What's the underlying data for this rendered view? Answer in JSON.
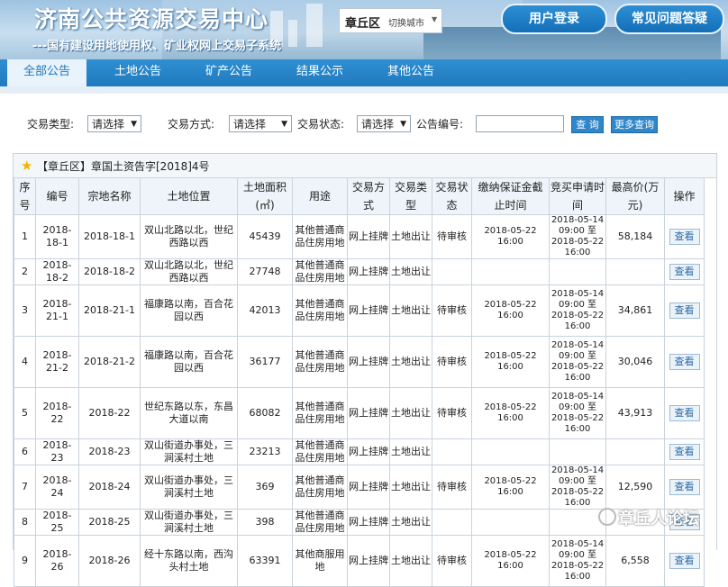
{
  "header": {
    "title": "济南公共资源交易中心",
    "subtitle": "---国有建设用地使用权、矿业权网上交易子系统",
    "city": "章丘区",
    "city_switch": "切换城市",
    "login_label": "用户登录",
    "faq_label": "常见问题答疑"
  },
  "nav": {
    "tabs": [
      "全部公告",
      "土地公告",
      "矿产公告",
      "结果公示",
      "其他公告"
    ],
    "active": "全部公告"
  },
  "filter": {
    "type_label": "交易类型:",
    "type_value": "请选择",
    "mode_label": "交易方式:",
    "mode_value": "请选择",
    "status_label": "交易状态:",
    "status_value": "请选择",
    "code_label": "公告编号:",
    "code_value": "",
    "query_label": "查 询",
    "more_label": "更多查询"
  },
  "caption": "【章丘区】章国土资告字[2018]4号",
  "table": {
    "headers": [
      "序号",
      "编号",
      "宗地名称",
      "土地位置",
      "土地面积(㎡)",
      "用途",
      "交易方式",
      "交易类型",
      "交易状态",
      "缴纳保证金截止时间",
      "竞买申请时间",
      "最高价(万元)",
      "操作"
    ],
    "rows": [
      {
        "no": "1",
        "code": "2018-18-1",
        "name": "2018-18-1",
        "loc": "双山北路以北，世纪西路以西",
        "area": "45439",
        "use": "其他普通商品住房用地",
        "mode": "网上挂牌",
        "type": "土地出让",
        "status": "待审核",
        "deposit": "2018-05-22 16:00",
        "apply": "2018-05-14 09:00 至 2018-05-22 16:00",
        "price": "58,184",
        "op": "查看"
      },
      {
        "no": "2",
        "code": "2018-18-2",
        "name": "2018-18-2",
        "loc": "双山北路以北，世纪西路以西",
        "area": "27748",
        "use": "其他普通商品住房用地",
        "mode": "网上挂牌",
        "type": "土地出让",
        "status": "",
        "deposit": "",
        "apply": "",
        "price": "",
        "op": "查看"
      },
      {
        "no": "3",
        "code": "2018-21-1",
        "name": "2018-21-1",
        "loc": "福康路以南，百合花园以西",
        "area": "42013",
        "use": "其他普通商品住房用地",
        "mode": "网上挂牌",
        "type": "土地出让",
        "status": "待审核",
        "deposit": "2018-05-22 16:00",
        "apply": "2018-05-14 09:00 至 2018-05-22 16:00",
        "price": "34,861",
        "op": "查看"
      },
      {
        "no": "4",
        "code": "2018-21-2",
        "name": "2018-21-2",
        "loc": "福康路以南，百合花园以西",
        "area": "36177",
        "use": "其他普通商品住房用地",
        "mode": "网上挂牌",
        "type": "土地出让",
        "status": "待审核",
        "deposit": "2018-05-22 16:00",
        "apply": "2018-05-14 09:00 至 2018-05-22 16:00",
        "price": "30,046",
        "op": "查看"
      },
      {
        "no": "5",
        "code": "2018-22",
        "name": "2018-22",
        "loc": "世纪东路以东，东昌大道以南",
        "area": "68082",
        "use": "其他普通商品住房用地",
        "mode": "网上挂牌",
        "type": "土地出让",
        "status": "待审核",
        "deposit": "2018-05-22 16:00",
        "apply": "2018-05-14 09:00 至 2018-05-22 16:00",
        "price": "43,913",
        "op": "查看"
      },
      {
        "no": "6",
        "code": "2018-23",
        "name": "2018-23",
        "loc": "双山街道办事处，三涧溪村土地",
        "area": "23213",
        "use": "其他普通商品住房用地",
        "mode": "网上挂牌",
        "type": "土地出让",
        "status": "",
        "deposit": "",
        "apply": "",
        "price": "",
        "op": "查看"
      },
      {
        "no": "7",
        "code": "2018-24",
        "name": "2018-24",
        "loc": "双山街道办事处，三涧溪村土地",
        "area": "369",
        "use": "其他普通商品住房用地",
        "mode": "网上挂牌",
        "type": "土地出让",
        "status": "待审核",
        "deposit": "2018-05-22 16:00",
        "apply": "2018-05-14 09:00 至 2018-05-22 16:00",
        "price": "12,590",
        "op": "查看"
      },
      {
        "no": "8",
        "code": "2018-25",
        "name": "2018-25",
        "loc": "双山街道办事处，三涧溪村土地",
        "area": "398",
        "use": "其他普通商品住房用地",
        "mode": "网上挂牌",
        "type": "土地出让",
        "status": "",
        "deposit": "",
        "apply": "",
        "price": "",
        "op": "查看"
      },
      {
        "no": "9",
        "code": "2018-26",
        "name": "2018-26",
        "loc": "经十东路以南，西沟头村土地",
        "area": "63391",
        "use": "其他商服用地",
        "mode": "网上挂牌",
        "type": "土地出让",
        "status": "待审核",
        "deposit": "2018-05-22 16:00",
        "apply": "2018-05-14 09:00 至 2018-05-22 16:00",
        "price": "6,558",
        "op": "查看"
      }
    ]
  },
  "watermark": "章丘人论坛"
}
